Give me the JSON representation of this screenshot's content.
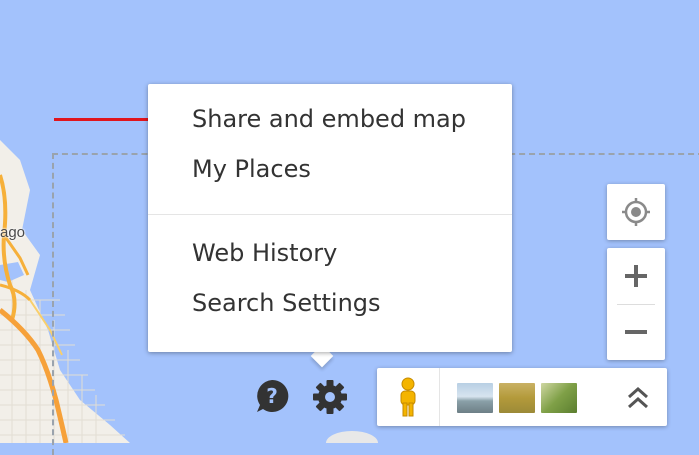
{
  "map": {
    "city_label": "ago",
    "colors": {
      "water": "#a3c2fc",
      "land": "#f2efe9",
      "highway": "#f6b03a",
      "major_road": "#f6a13a",
      "annotation_arrow": "#e0151c"
    }
  },
  "settings_menu": {
    "items": [
      {
        "label": "Share and embed map"
      },
      {
        "label": "My Places"
      },
      {
        "label": "Web History"
      },
      {
        "label": "Search Settings"
      }
    ]
  },
  "controls": {
    "my_location_icon": "target-icon",
    "zoom_in_icon": "plus-icon",
    "zoom_out_icon": "minus-icon",
    "help_icon": "help-bubble-icon",
    "settings_icon": "gear-icon",
    "pegman_icon": "pegman-icon",
    "expand_icon": "double-chevron-up-icon"
  }
}
